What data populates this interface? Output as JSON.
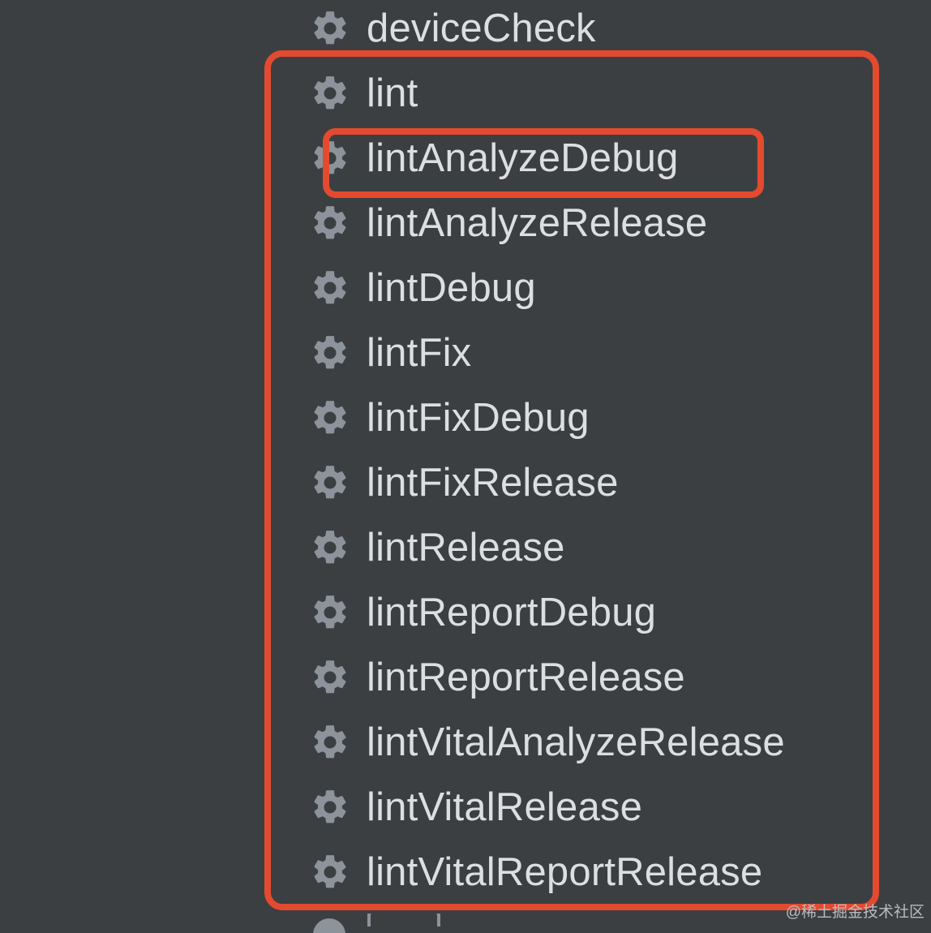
{
  "tasks": [
    {
      "label": "deviceCheck",
      "icon": "gear-icon"
    },
    {
      "label": "lint",
      "icon": "gear-icon"
    },
    {
      "label": "lintAnalyzeDebug",
      "icon": "gear-icon"
    },
    {
      "label": "lintAnalyzeRelease",
      "icon": "gear-icon"
    },
    {
      "label": "lintDebug",
      "icon": "gear-icon"
    },
    {
      "label": "lintFix",
      "icon": "gear-icon"
    },
    {
      "label": "lintFixDebug",
      "icon": "gear-icon"
    },
    {
      "label": "lintFixRelease",
      "icon": "gear-icon"
    },
    {
      "label": "lintRelease",
      "icon": "gear-icon"
    },
    {
      "label": "lintReportDebug",
      "icon": "gear-icon"
    },
    {
      "label": "lintReportRelease",
      "icon": "gear-icon"
    },
    {
      "label": "lintVitalAnalyzeRelease",
      "icon": "gear-icon"
    },
    {
      "label": "lintVitalRelease",
      "icon": "gear-icon"
    },
    {
      "label": "lintVitalReportRelease",
      "icon": "gear-icon"
    }
  ],
  "colors": {
    "background": "#3c3f41",
    "text": "#dcdfe2",
    "icon": "#8c939a",
    "highlight": "#e34a2f"
  },
  "watermark": "@稀土掘金技术社区"
}
